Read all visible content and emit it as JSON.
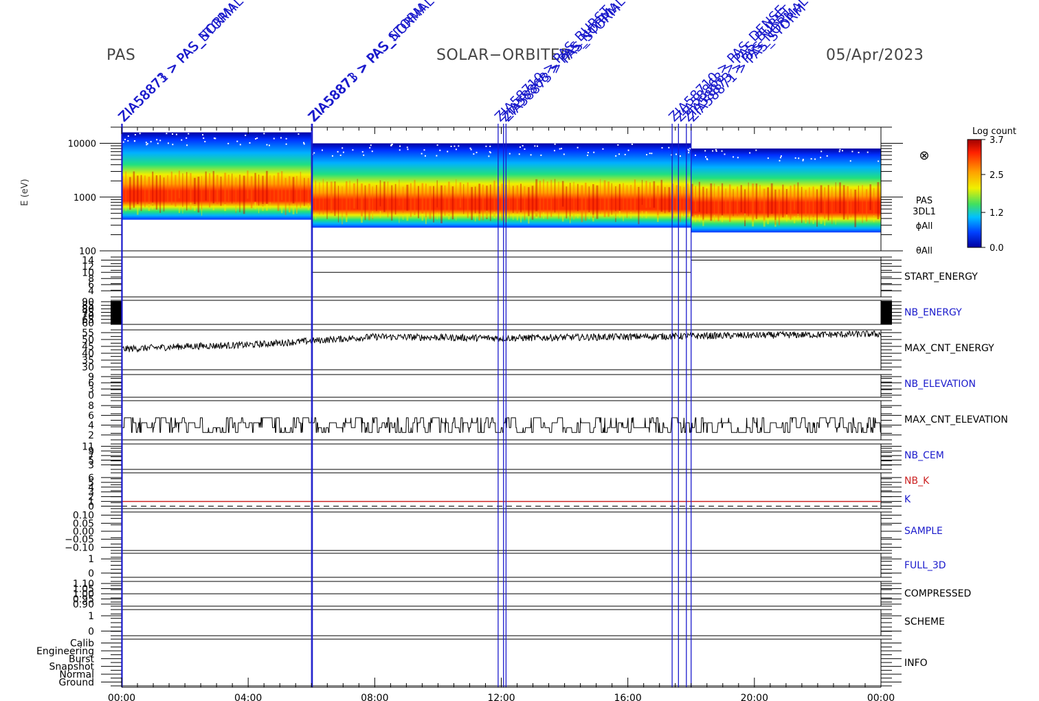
{
  "header": {
    "instrument": "PAS",
    "mission": "SOLAR−ORBITER",
    "date": "05/Apr/2023"
  },
  "colors": {
    "frame": "#000000",
    "annotation_blue": "#1a1acc",
    "nb_k_red": "#cc2222",
    "trace": "#000000",
    "spectrogram_scale": [
      "#0000a0",
      "#0030ff",
      "#00b0ff",
      "#20e080",
      "#80f020",
      "#f0f000",
      "#ffa000",
      "#ff3000",
      "#c80000"
    ]
  },
  "colorbar": {
    "title": "Log count",
    "ticks": [
      {
        "label": "3.7",
        "value": 3.7
      },
      {
        "label": "2.5",
        "value": 2.5
      },
      {
        "label": "1.2",
        "value": 1.2
      },
      {
        "label": "0.0",
        "value": 0.0
      }
    ]
  },
  "annotations": {
    "events": [
      {
        "time": 0.0,
        "label": "ZIA58873 > PAS_NORMAL"
      },
      {
        "time": 0.02,
        "label": "ZIA58871 > PAS_STORM"
      },
      {
        "time": 6.0,
        "label": "ZIA58871 > PAS_STORM"
      },
      {
        "time": 6.03,
        "label": "ZIA58873 > PAS_NORMAL"
      },
      {
        "time": 11.9,
        "label": "ZIA58710 > PAS_BURST"
      },
      {
        "time": 12.07,
        "label": "ZIA58868 > PAS_NORMAL"
      },
      {
        "time": 12.15,
        "label": "ZIA58873 > PAS_STORM"
      },
      {
        "time": 17.4,
        "label": "ZIA58710 > PAS_DENSE"
      },
      {
        "time": 17.6,
        "label": "ZIA58868 > PAS_BURST"
      },
      {
        "time": 17.85,
        "label": "ZIA58873 > PAS_NORMAL"
      },
      {
        "time": 18.0,
        "label": "ZIA58871 > PAS_STORM"
      }
    ]
  },
  "time_axis": {
    "start_hour": 0,
    "end_hour": 24,
    "tick_labels": [
      {
        "hour": 0,
        "label": "00:00"
      },
      {
        "hour": 4,
        "label": "04:00"
      },
      {
        "hour": 8,
        "label": "08:00"
      },
      {
        "hour": 12,
        "label": "12:00"
      },
      {
        "hour": 16,
        "label": "16:00"
      },
      {
        "hour": 20,
        "label": "20:00"
      },
      {
        "hour": 24,
        "label": "00:00"
      }
    ]
  },
  "chart_data": [
    {
      "type": "heatmap",
      "name": "energy_spectrogram",
      "ylabel": "E (eV)",
      "yscale": "log",
      "ylim": [
        100,
        20000
      ],
      "ytick_labels": [
        {
          "value": 10000,
          "label": "10000"
        },
        {
          "value": 1000,
          "label": "1000"
        },
        {
          "value": 100,
          "label": "100"
        }
      ],
      "right_labels": [
        "PAS",
        "3DL1",
        "ϕAll",
        "θAll"
      ],
      "symbol": "⊗",
      "segments": [
        {
          "t0": 0.0,
          "t1": 6.0,
          "emin": 380,
          "emax": 16000,
          "peak_ev": 1300
        },
        {
          "t0": 6.0,
          "t1": 18.0,
          "emin": 270,
          "emax": 10000,
          "peak_ev": 900
        },
        {
          "t0": 18.0,
          "t1": 24.0,
          "emin": 220,
          "emax": 8000,
          "peak_ev": 800
        }
      ]
    },
    {
      "type": "line",
      "name": "START_ENERGY",
      "label_color": "#000000",
      "ylim": [
        2,
        15
      ],
      "ytick_labels": [
        {
          "value": 14,
          "label": "14"
        },
        {
          "value": 12,
          "label": "12"
        },
        {
          "value": 10,
          "label": "10"
        },
        {
          "value": 8,
          "label": "8"
        },
        {
          "value": 6,
          "label": "6"
        },
        {
          "value": 4,
          "label": "4"
        }
      ],
      "steps": [
        {
          "t0": 0,
          "t1": 6.0,
          "v": null
        },
        {
          "t0": 6.0,
          "t1": 18.0,
          "v": 10
        },
        {
          "t0": 18.0,
          "t1": 24,
          "v": 14
        }
      ]
    },
    {
      "type": "line",
      "name": "NB_ENERGY",
      "label_color": "#1a1acc",
      "ylim": [
        58,
        92
      ],
      "ytick_labels": [
        {
          "value": 90,
          "label": "90"
        },
        {
          "value": 85,
          "label": "85"
        },
        {
          "value": 80,
          "label": "80"
        },
        {
          "value": 75,
          "label": "75"
        },
        {
          "value": 70,
          "label": "70"
        },
        {
          "value": 65,
          "label": "65"
        },
        {
          "value": 60,
          "label": "60"
        }
      ],
      "steps": []
    },
    {
      "type": "line",
      "name": "MAX_CNT_ENERGY",
      "label_color": "#000000",
      "ylim": [
        28,
        57
      ],
      "ytick_labels": [
        {
          "value": 55,
          "label": "55"
        },
        {
          "value": 50,
          "label": "50"
        },
        {
          "value": 45,
          "label": "45"
        },
        {
          "value": 40,
          "label": "40"
        },
        {
          "value": 35,
          "label": "35"
        },
        {
          "value": 30,
          "label": "30"
        }
      ],
      "trend": [
        {
          "t": 0,
          "v": 43
        },
        {
          "t": 2,
          "v": 45
        },
        {
          "t": 4,
          "v": 46
        },
        {
          "t": 6,
          "v": 49
        },
        {
          "t": 8,
          "v": 52
        },
        {
          "t": 12,
          "v": 51
        },
        {
          "t": 16,
          "v": 52
        },
        {
          "t": 20,
          "v": 53
        },
        {
          "t": 24,
          "v": 54
        }
      ],
      "noise": 2.5
    },
    {
      "type": "line",
      "name": "NB_ELEVATION",
      "label_color": "#1a1acc",
      "ylim": [
        -1,
        10
      ],
      "ytick_labels": [
        {
          "value": 9,
          "label": "9"
        },
        {
          "value": 6,
          "label": "6"
        },
        {
          "value": 3,
          "label": "3"
        },
        {
          "value": 0,
          "label": "0"
        }
      ],
      "steps": []
    },
    {
      "type": "line",
      "name": "MAX_CNT_ELEVATION",
      "label_color": "#000000",
      "ylim": [
        1,
        9
      ],
      "ytick_labels": [
        {
          "value": 8,
          "label": "8"
        },
        {
          "value": 6,
          "label": "6"
        },
        {
          "value": 4,
          "label": "4"
        },
        {
          "value": 2,
          "label": "2"
        }
      ],
      "levels": [
        2.5,
        3.5,
        4.5,
        5.5
      ]
    },
    {
      "type": "line",
      "name": "NB_CEM",
      "label_color": "#1a1acc",
      "ylim": [
        1,
        12
      ],
      "ytick_labels": [
        {
          "value": 11,
          "label": "11"
        },
        {
          "value": 9,
          "label": "9"
        },
        {
          "value": 7,
          "label": "7"
        },
        {
          "value": 5,
          "label": "5"
        },
        {
          "value": 3,
          "label": "3"
        }
      ],
      "steps": []
    },
    {
      "type": "line",
      "name": "NB_K",
      "name2": "K",
      "label_color": "#cc2222",
      "label2_color": "#1a1acc",
      "ylim": [
        -0.5,
        7
      ],
      "ytick_labels": [
        {
          "value": 6,
          "label": "6"
        },
        {
          "value": 5,
          "label": "5"
        },
        {
          "value": 4,
          "label": "4"
        },
        {
          "value": 3,
          "label": "3"
        },
        {
          "value": 2,
          "label": "2"
        },
        {
          "value": 1,
          "label": "1"
        },
        {
          "value": 0,
          "label": "0"
        }
      ],
      "solid_value": 1,
      "dashed_value": 0
    },
    {
      "type": "line",
      "name": "SAMPLE",
      "label_color": "#1a1acc",
      "ylim": [
        -0.12,
        0.12
      ],
      "ytick_labels": [
        {
          "value": 0.1,
          "label": "0.10"
        },
        {
          "value": 0.05,
          "label": "0.05"
        },
        {
          "value": 0.0,
          "label": "0.00"
        },
        {
          "value": -0.05,
          "label": "−0.05"
        },
        {
          "value": -0.1,
          "label": "−0.10"
        }
      ],
      "steps": []
    },
    {
      "type": "line",
      "name": "FULL_3D",
      "label_color": "#1a1acc",
      "ylim": [
        -0.3,
        1.4
      ],
      "ytick_labels": [
        {
          "value": 1,
          "label": "1"
        },
        {
          "value": 0,
          "label": "0"
        }
      ],
      "steps": []
    },
    {
      "type": "line",
      "name": "COMPRESSED",
      "label_color": "#000000",
      "ylim": [
        0.88,
        1.12
      ],
      "ytick_labels": [
        {
          "value": 1.1,
          "label": "1.10"
        },
        {
          "value": 1.05,
          "label": "1.05"
        },
        {
          "value": 1.0,
          "label": "1.00"
        },
        {
          "value": 0.95,
          "label": "0.95"
        },
        {
          "value": 0.9,
          "label": "0.90"
        }
      ],
      "steps": [
        {
          "t0": 0,
          "t1": 24,
          "v": 1.0
        }
      ]
    },
    {
      "type": "line",
      "name": "SCHEME",
      "label_color": "#000000",
      "ylim": [
        -0.3,
        1.4
      ],
      "ytick_labels": [
        {
          "value": 1,
          "label": "1"
        },
        {
          "value": 0,
          "label": "0"
        }
      ],
      "steps": []
    },
    {
      "type": "line",
      "name": "INFO",
      "label_color": "#000000",
      "ylim": [
        -0.5,
        5.5
      ],
      "ytick_labels": [
        {
          "value": 5,
          "label": "Calib"
        },
        {
          "value": 4,
          "label": "Engineering"
        },
        {
          "value": 3,
          "label": "Burst"
        },
        {
          "value": 2,
          "label": "Snapshot"
        },
        {
          "value": 1,
          "label": "Normal"
        },
        {
          "value": 0,
          "label": "Ground"
        }
      ],
      "steps": []
    }
  ]
}
